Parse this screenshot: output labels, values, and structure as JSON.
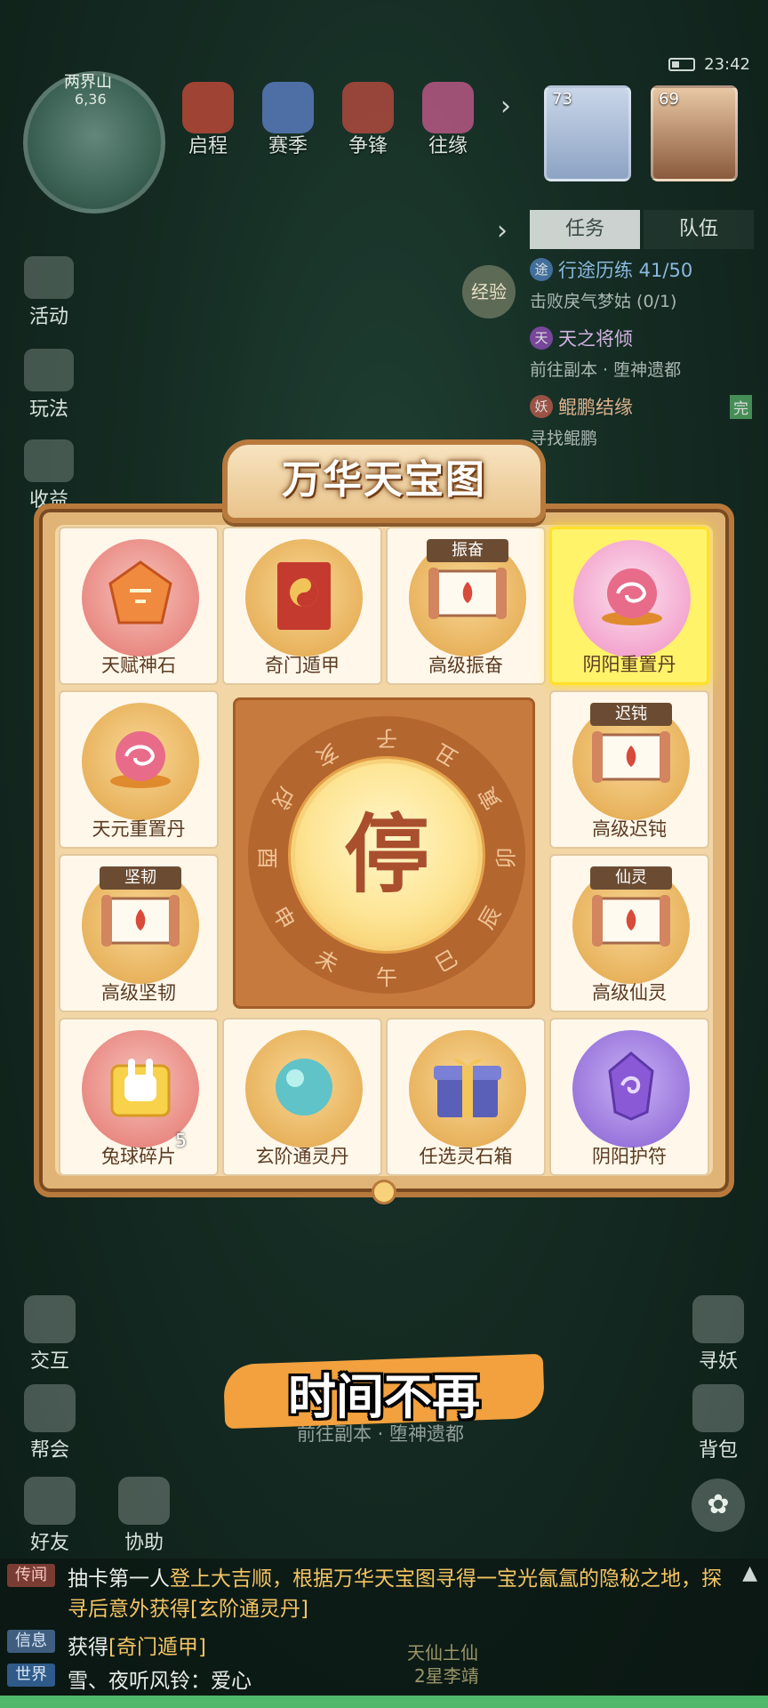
{
  "status": {
    "time": "23:42"
  },
  "minimap": {
    "name": "两界山",
    "coord": "6,36"
  },
  "top_icons": [
    {
      "label": "启程",
      "icon": "scroll-icon"
    },
    {
      "label": "赛季",
      "icon": "season-icon"
    },
    {
      "label": "争锋",
      "icon": "banner-icon"
    },
    {
      "label": "往缘",
      "icon": "fate-icon"
    }
  ],
  "party": [
    {
      "level": "73"
    },
    {
      "level": "69"
    }
  ],
  "tabs": {
    "task": "任务",
    "team": "队伍"
  },
  "left_side": [
    "活动",
    "玩法",
    "收益"
  ],
  "exp_label": "经验",
  "quests": [
    {
      "badge": "途",
      "title": "行途历练 41/50",
      "sub": "击败戾气梦姑 (0/1)"
    },
    {
      "badge": "天",
      "title": "天之将倾",
      "sub": "前往副本 · 堕神遗都"
    },
    {
      "badge": "妖",
      "title": "鲲鹏结缘",
      "sub": "寻找鲲鹏",
      "done": "完"
    }
  ],
  "board": {
    "title": "万华天宝图",
    "center": "停",
    "zodiac": [
      "子",
      "丑",
      "寅",
      "卯",
      "辰",
      "巳",
      "午",
      "未",
      "申",
      "酉",
      "戌",
      "亥"
    ],
    "items": [
      {
        "name": "天赋神石",
        "icon": "talent-stone-icon",
        "style": "pink"
      },
      {
        "name": "奇门遁甲",
        "icon": "book-icon",
        "style": "gold"
      },
      {
        "name": "高级振奋",
        "icon": "scroll-icon",
        "style": "gold",
        "tag": "振奋"
      },
      {
        "name": "阴阳重置丹",
        "icon": "pearl-icon",
        "style": "light",
        "selected": true
      },
      {
        "name": "天元重置丹",
        "icon": "pearl-icon",
        "style": "gold"
      },
      {
        "name": "高级迟钝",
        "icon": "scroll-icon",
        "style": "gold",
        "tag": "迟钝"
      },
      {
        "name": "高级坚韧",
        "icon": "scroll-icon",
        "style": "gold",
        "tag": "坚韧"
      },
      {
        "name": "高级仙灵",
        "icon": "scroll-icon",
        "style": "gold",
        "tag": "仙灵"
      },
      {
        "name": "兔球碎片",
        "icon": "rabbit-puzzle-icon",
        "style": "pink",
        "count": "5"
      },
      {
        "name": "玄阶通灵丹",
        "icon": "jade-orb-icon",
        "style": "gold"
      },
      {
        "name": "任选灵石箱",
        "icon": "gift-box-icon",
        "style": "gold"
      },
      {
        "name": "阴阳护符",
        "icon": "amulet-icon",
        "style": "violet"
      }
    ]
  },
  "bottom_left": [
    "交互",
    "帮会",
    "好友",
    "协助"
  ],
  "bottom_right": [
    "寻妖",
    "背包"
  ],
  "caption": "时间不再",
  "nav_hint": "前往副本 · 堕神遗都",
  "chat": [
    {
      "tag": "传闻",
      "text": "抽卡第一人",
      "highlight": "登上大吉顺，根据万华天宝图寻得一宝光氤氲的隐秘之地，探寻后意外获得[玄阶通灵丹]"
    },
    {
      "tag": "信息",
      "text": "获得",
      "highlight": "[奇门遁甲]"
    },
    {
      "tag": "世界",
      "text": "雪、夜听风铃：爱心",
      "highlight": ""
    }
  ],
  "world_name": "天仙土仙",
  "world_sub": "2星李靖"
}
